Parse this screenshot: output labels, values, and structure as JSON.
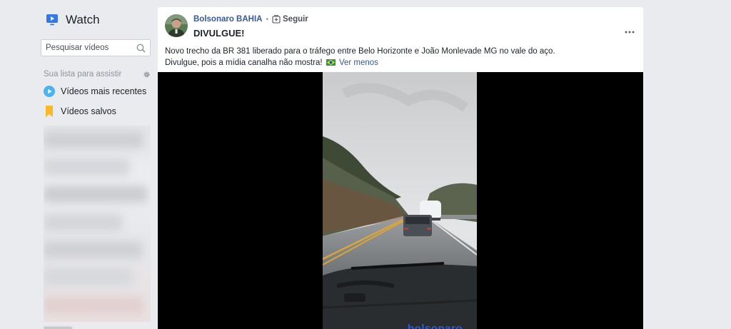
{
  "sidebar": {
    "title": "Watch",
    "search_placeholder": "Pesquisar vídeos",
    "section_title": "Sua lista para assistir",
    "items": [
      {
        "label": "Vídeos mais recentes",
        "icon": "play-circle-icon"
      },
      {
        "label": "Vídeos salvos",
        "icon": "bookmark-icon"
      }
    ]
  },
  "post": {
    "author": "Bolsonaro BAHIA",
    "separator": "•",
    "follow_label": "Seguir",
    "title": "DIVULGUE!",
    "text_line1": "Novo trecho da BR 381 liberado para o tráfego entre Belo Horizonte e João Monlevade MG no vale do aço.",
    "text_line2": "Divulgue, pois a mídia canalha não mostra!",
    "see_less": "Ver menos",
    "video_watermark": "bolsonaro"
  },
  "colors": {
    "background": "#e9ebee",
    "link": "#385898",
    "play_icon": "#4cb3f0",
    "bookmark_icon": "#f7b928"
  }
}
